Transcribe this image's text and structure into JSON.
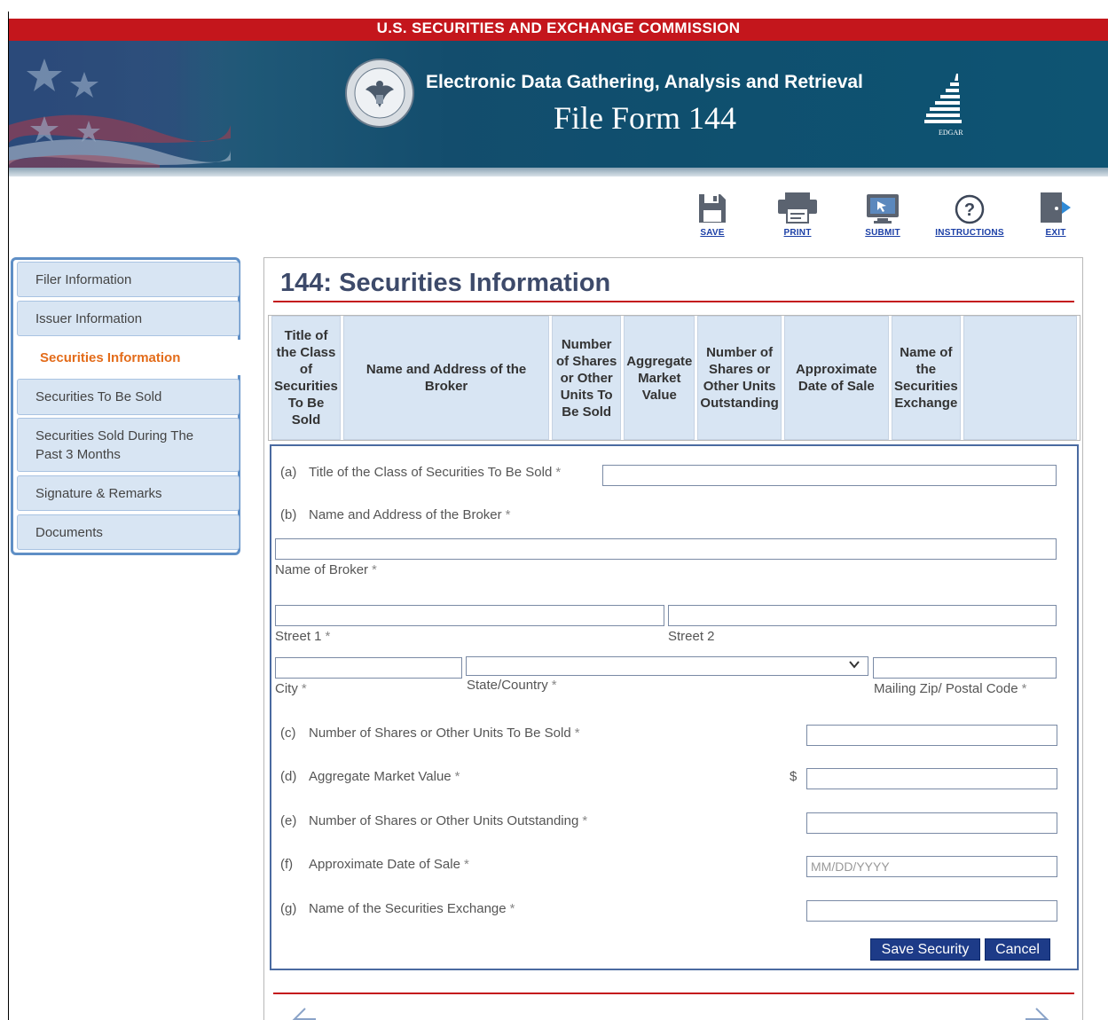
{
  "banner": {
    "agency": "U.S. SECURITIES AND EXCHANGE COMMISSION",
    "system_name": "Electronic Data Gathering, Analysis and Retrieval",
    "form_title": "File Form 144",
    "logo_text": "EDGAR"
  },
  "toolbar": {
    "save": "SAVE",
    "print": "PRINT",
    "submit": "SUBMIT",
    "instructions": "INSTRUCTIONS",
    "exit": "EXIT"
  },
  "sidebar": {
    "items": [
      {
        "label": "Filer Information"
      },
      {
        "label": "Issuer Information"
      },
      {
        "label": "Securities Information",
        "active": true
      },
      {
        "label": "Securities To Be Sold"
      },
      {
        "label": "Securities Sold During The Past 3 Months"
      },
      {
        "label": "Signature & Remarks"
      },
      {
        "label": "Documents"
      }
    ]
  },
  "main": {
    "title": "144: Securities Information",
    "table_headers": [
      "Title of the Class of Securities To Be Sold",
      "Name and Address of the Broker",
      "Number of Shares or Other Units To Be Sold",
      "Aggregate Market Value",
      "Number of Shares or Other Units Outstanding",
      "Approximate Date of Sale",
      "Name of the Securities Exchange",
      ""
    ]
  },
  "form": {
    "a": {
      "letter": "(a)",
      "label": "Title of the Class of Securities To Be Sold",
      "value": ""
    },
    "b": {
      "letter": "(b)",
      "label": "Name and Address of the Broker"
    },
    "broker_name": {
      "label": "Name of Broker",
      "value": ""
    },
    "street1": {
      "label": "Street 1",
      "value": ""
    },
    "street2": {
      "label": "Street 2",
      "value": ""
    },
    "city": {
      "label": "City",
      "value": ""
    },
    "state": {
      "label": "State/Country",
      "value": ""
    },
    "zip": {
      "label": "Mailing Zip/ Postal Code",
      "value": ""
    },
    "c": {
      "letter": "(c)",
      "label": "Number of Shares or Other Units To Be Sold",
      "value": ""
    },
    "d": {
      "letter": "(d)",
      "label": "Aggregate Market Value",
      "currency": "$",
      "value": ""
    },
    "e": {
      "letter": "(e)",
      "label": "Number of Shares or Other Units Outstanding",
      "value": ""
    },
    "f": {
      "letter": "(f)",
      "label": "Approximate Date of Sale",
      "value": "",
      "placeholder": "MM/DD/YYYY"
    },
    "g": {
      "letter": "(g)",
      "label": "Name of the Securities Exchange",
      "value": ""
    },
    "required_marker": "*",
    "save_button": "Save Security",
    "cancel_button": "Cancel"
  },
  "colors": {
    "banner_red": "#c4161c",
    "banner_teal": "#0f4f6e",
    "active_tab": "#e36c1a",
    "button_blue": "#1d3b88",
    "link_blue": "#1b3fa6"
  },
  "icons": [
    "save-icon",
    "print-icon",
    "submit-icon",
    "help-icon",
    "exit-icon",
    "chevron-down-icon",
    "seal-icon",
    "edgar-logo-icon",
    "previous-arrow-icon",
    "next-arrow-icon"
  ]
}
